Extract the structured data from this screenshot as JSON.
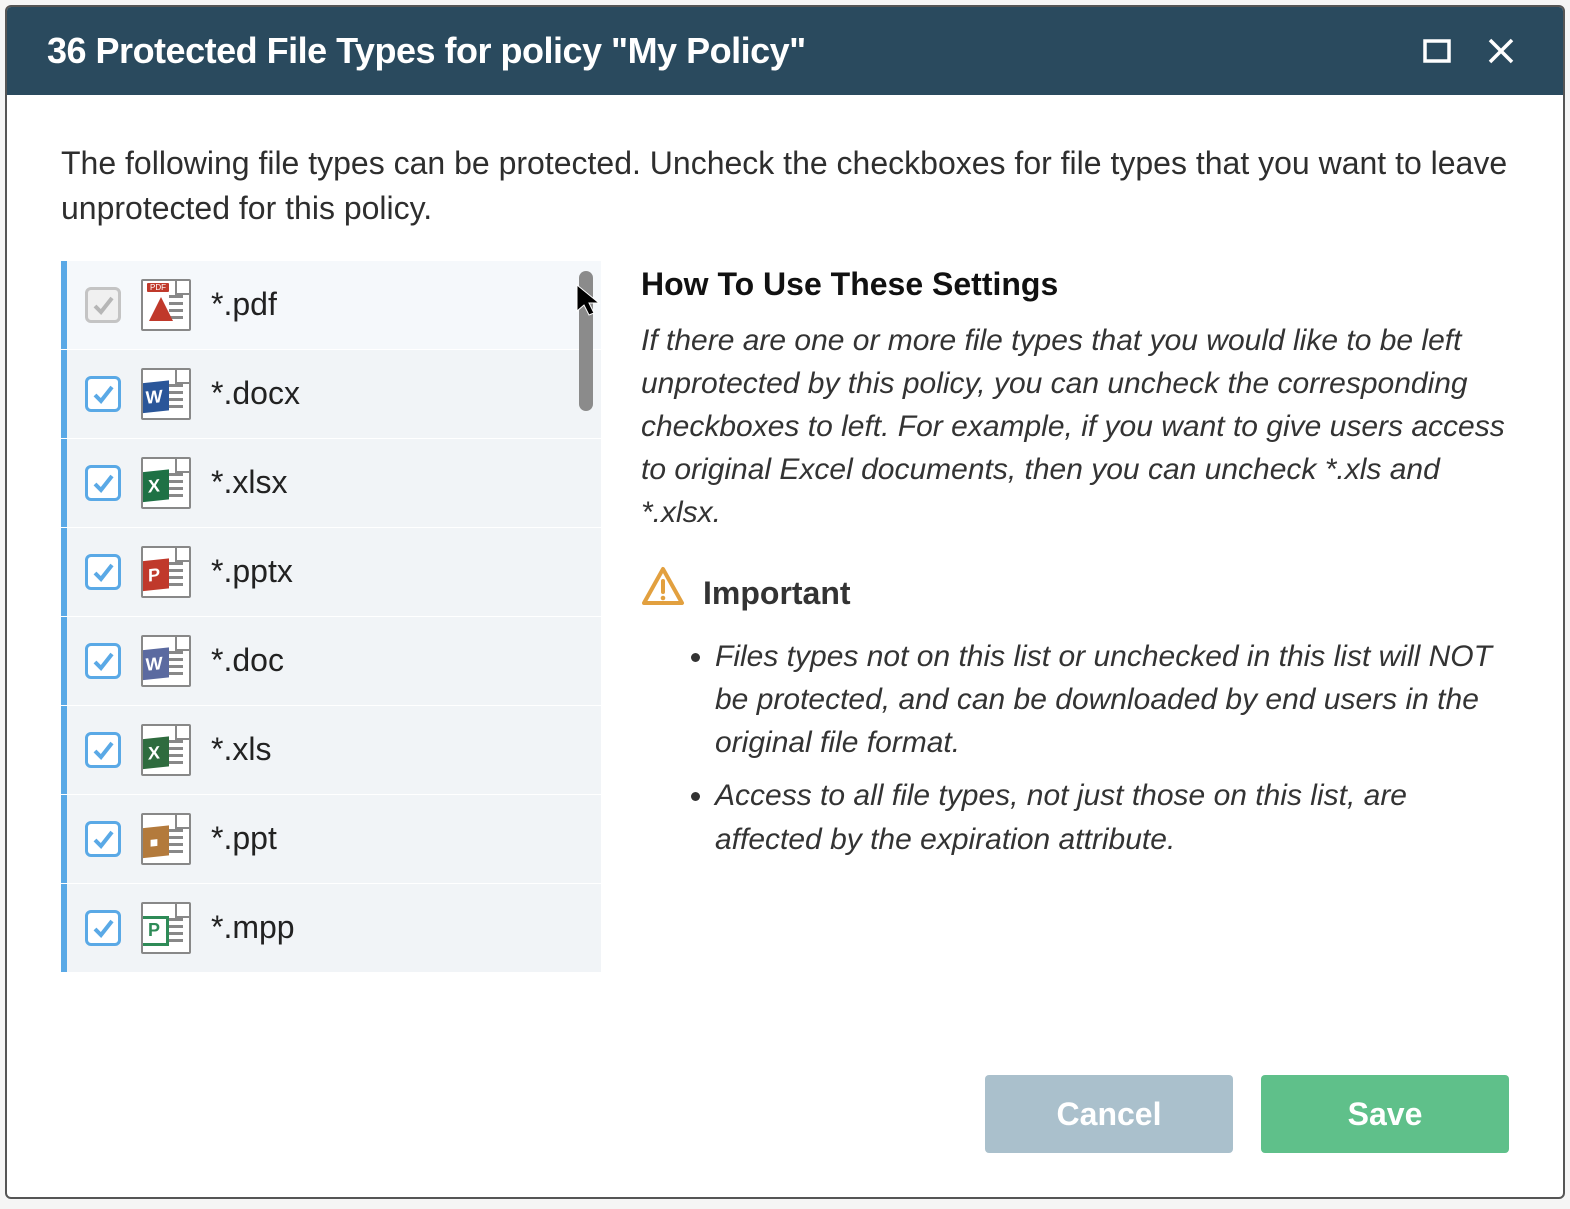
{
  "title": "36 Protected File Types for policy \"My Policy\"",
  "intro": "The following file types can be protected. Uncheck the checkboxes for file types that you want to leave unprotected for this policy.",
  "files": [
    {
      "ext": "*.pdf",
      "icon": "pdf",
      "checked": true,
      "disabled": true
    },
    {
      "ext": "*.docx",
      "icon": "word",
      "checked": true,
      "disabled": false
    },
    {
      "ext": "*.xlsx",
      "icon": "excel",
      "checked": true,
      "disabled": false
    },
    {
      "ext": "*.pptx",
      "icon": "ppt",
      "checked": true,
      "disabled": false
    },
    {
      "ext": "*.doc",
      "icon": "wordold",
      "checked": true,
      "disabled": false
    },
    {
      "ext": "*.xls",
      "icon": "excelold",
      "checked": true,
      "disabled": false
    },
    {
      "ext": "*.ppt",
      "icon": "pptold",
      "checked": true,
      "disabled": false
    },
    {
      "ext": "*.mpp",
      "icon": "project",
      "checked": true,
      "disabled": false
    }
  ],
  "info": {
    "heading": "How To Use These Settings",
    "desc": "If there are one or more file types that you would like to be left unprotected by this policy, you can uncheck the corresponding checkboxes to left. For example, if you want to give users access to original Excel documents, then you can uncheck *.xls and *.xlsx.",
    "important_label": "Important",
    "bullets": [
      "Files types not on this list or unchecked in this list will NOT be protected, and can be downloaded by end users in the original file format.",
      "Access to all file types, not just those on this list, are affected by the expiration attribute."
    ]
  },
  "buttons": {
    "cancel": "Cancel",
    "save": "Save"
  },
  "colors": {
    "word": "#2a5699",
    "excel": "#1e7145",
    "ppt": "#c0392b",
    "wordold": "#5b6aa0",
    "excelold": "#2e6b3e",
    "pptold": "#b37a3c",
    "project": "#2e8b57",
    "pdf": "#c0392b"
  }
}
